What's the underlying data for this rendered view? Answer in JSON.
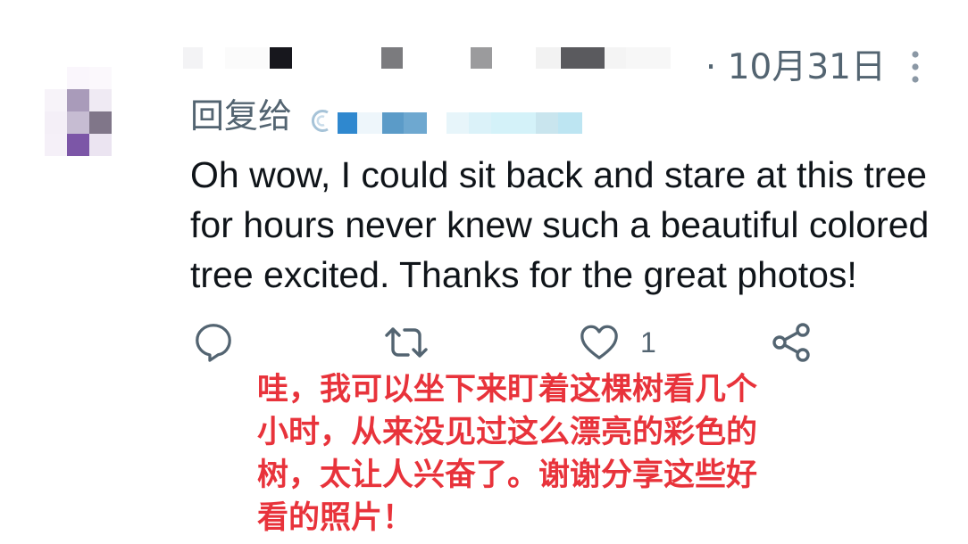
{
  "reply_context": {
    "prefix": "回复给"
  },
  "tweet": {
    "separator": "·",
    "date": "10月31日",
    "text_lines": [
      "Oh wow, I could sit back and stare at this tree",
      "for hours never knew such a beautiful colored",
      "tree excited. Thanks for the great photos!"
    ]
  },
  "actions": {
    "reply": {
      "icon": "reply-icon"
    },
    "retweet": {
      "icon": "retweet-icon"
    },
    "like": {
      "icon": "heart-icon",
      "count": "1"
    },
    "share": {
      "icon": "share-icon"
    }
  },
  "more_menu": {
    "icon": "more-vertical-icon"
  },
  "translation": {
    "lines": [
      "哇，我可以坐下来盯着这棵树看几个",
      "小时，从来没见过这么漂亮的彩色的",
      "树，太让人兴奋了。谢谢分享这些好",
      "看的照片！"
    ]
  },
  "colors": {
    "text": "#0f1419",
    "secondary": "#536471",
    "icon": "#536471",
    "more": "#8b98a5",
    "translation": "#e8333b"
  }
}
